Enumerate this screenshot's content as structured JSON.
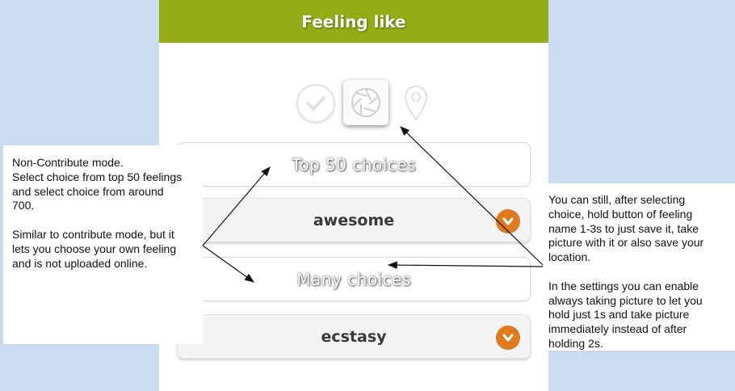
{
  "app": {
    "title": "Feeling like",
    "colors": {
      "header": "#94ad17",
      "accent": "#e07a1e",
      "background": "#c9dcf0"
    }
  },
  "mode_icons": [
    {
      "icon": "checkmark-circle-icon",
      "state": "inactive"
    },
    {
      "icon": "camera-shutter-icon",
      "state": "selected"
    },
    {
      "icon": "location-pin-icon",
      "state": "inactive"
    }
  ],
  "rows": {
    "top50_label": "Top 50 choices",
    "selection_1": "awesome",
    "many_label": "Many choices",
    "selection_2": "ecstasy"
  },
  "annotations": {
    "left": {
      "line1": "Non-Contribute mode.",
      "line2": "Select choice from top 50 feelings",
      "line3": "and select choice from around",
      "line4": "700.",
      "line5": "Similar to contribute mode, but it",
      "line6": "lets you choose your own feeling",
      "line7": "and is not uploaded online."
    },
    "right": {
      "line1": "You can still, after selecting",
      "line2": "choice, hold button of feeling",
      "line3": "name 1-3s to just save it, take",
      "line4": "picture with it or also save your",
      "line5": "location.",
      "line6": "In the settings you can enable",
      "line7": "always taking picture to let you",
      "line8": "hold just 1s and take picture",
      "line9": "immediately instead of after",
      "line10": "holding 2s."
    }
  }
}
